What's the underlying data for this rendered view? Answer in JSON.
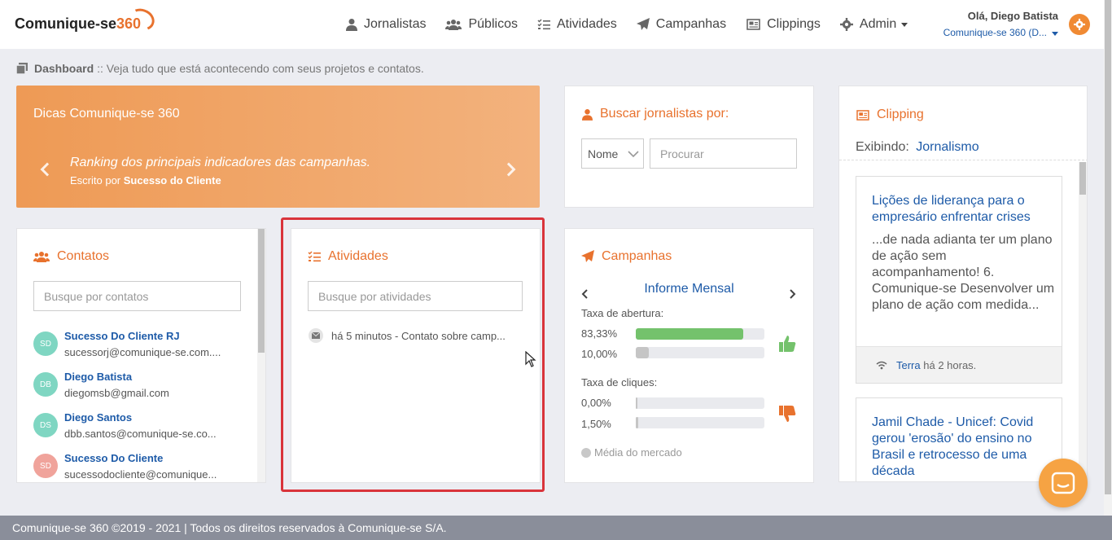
{
  "header": {
    "logo_text": "Comunique-se",
    "logo_num": "360",
    "nav": [
      {
        "label": "Jornalistas",
        "icon": "user-icon"
      },
      {
        "label": "Públicos",
        "icon": "users-icon"
      },
      {
        "label": "Atividades",
        "icon": "tasks-icon"
      },
      {
        "label": "Campanhas",
        "icon": "paper-plane-icon"
      },
      {
        "label": "Clippings",
        "icon": "newspaper-icon"
      },
      {
        "label": "Admin",
        "icon": "gear-icon"
      }
    ],
    "user_greeting": "Olá, Diego Batista",
    "user_org": "Comunique-se 360 (D..."
  },
  "breadcrumb": {
    "title": "Dashboard",
    "text": ":: Veja tudo que está acontecendo com seus projetos e contatos."
  },
  "tips": {
    "title": "Dicas Comunique-se 360",
    "message": "Ranking dos principais indicadores das campanhas.",
    "by_prefix": "Escrito por",
    "by_author": "Sucesso do Cliente"
  },
  "search_journalists": {
    "title": "Buscar jornalistas por:",
    "select_value": "Nome",
    "placeholder": "Procurar"
  },
  "clipping": {
    "title": "Clipping",
    "showing_label": "Exibindo:",
    "showing_value": "Jornalismo",
    "articles": [
      {
        "title": "Lições de liderança para o empresário enfrentar crises",
        "excerpt": "...de nada adianta ter um plano de ação sem acompanhamento! 6. Comunique-se Desenvolver um plano de ação com medida...",
        "source": "Terra",
        "time": "há 2 horas."
      },
      {
        "title": "Jamil Chade - Unicef: Covid gerou 'erosão' do ensino no Brasil e retrocesso de uma década"
      }
    ]
  },
  "contacts": {
    "title": "Contatos",
    "placeholder": "Busque por contatos",
    "items": [
      {
        "initials": "SD",
        "name": "Sucesso Do Cliente RJ",
        "email": "sucessorj@comunique-se.com....",
        "color": "#7fd6c2"
      },
      {
        "initials": "DB",
        "name": "Diego Batista",
        "email": "diegomsb@gmail.com",
        "color": "#7fd6c2"
      },
      {
        "initials": "DS",
        "name": "Diego Santos",
        "email": "dbb.santos@comunique-se.co...",
        "color": "#7fd6c2"
      },
      {
        "initials": "SD",
        "name": "Sucesso Do Cliente",
        "email": "sucessodocliente@comunique...",
        "color": "#f0a39b"
      }
    ]
  },
  "activities": {
    "title": "Atividades",
    "placeholder": "Busque por atividades",
    "items": [
      {
        "text": "há 5 minutos - Contato sobre camp..."
      }
    ]
  },
  "campaigns": {
    "title": "Campanhas",
    "name": "Informe Mensal",
    "open_rate_label": "Taxa de abertura:",
    "open_rates": [
      {
        "label": "83,33%",
        "value": 83.33,
        "color": "#74c26c"
      },
      {
        "label": "10,00%",
        "value": 10.0,
        "color": "#c5c5c5"
      }
    ],
    "click_rate_label": "Taxa de cliques:",
    "click_rates": [
      {
        "label": "0,00%",
        "value": 0.0,
        "color": "#c5c5c5"
      },
      {
        "label": "1,50%",
        "value": 1.5,
        "color": "#c5c5c5"
      }
    ],
    "market_label": "Média do mercado"
  },
  "footer": {
    "text": "Comunique-se 360 ©2019 - 2021 | Todos os direitos reservados à Comunique-se S/A."
  },
  "colors": {
    "accent": "#e8722e",
    "link": "#1e5ba8",
    "highlight": "#d9343b"
  }
}
